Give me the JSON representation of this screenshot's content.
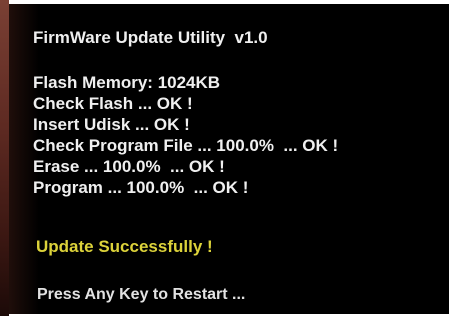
{
  "utility": {
    "title": "FirmWare Update Utility  v1.0"
  },
  "log": {
    "flash_memory": "Flash Memory: 1024KB",
    "check_flash": "Check Flash ... OK !",
    "insert_udisk": "Insert Udisk ... OK !",
    "check_program_file": "Check Program File ... 100.0%  ... OK !",
    "erase": "Erase ... 100.0%  ... OK !",
    "program": "Program ... 100.0%  ... OK !"
  },
  "status": {
    "message": "Update Successfully !",
    "prompt": "Press Any Key to Restart ..."
  },
  "colors": {
    "background": "#000000",
    "text": "#efefef",
    "success": "#dcd23a"
  }
}
